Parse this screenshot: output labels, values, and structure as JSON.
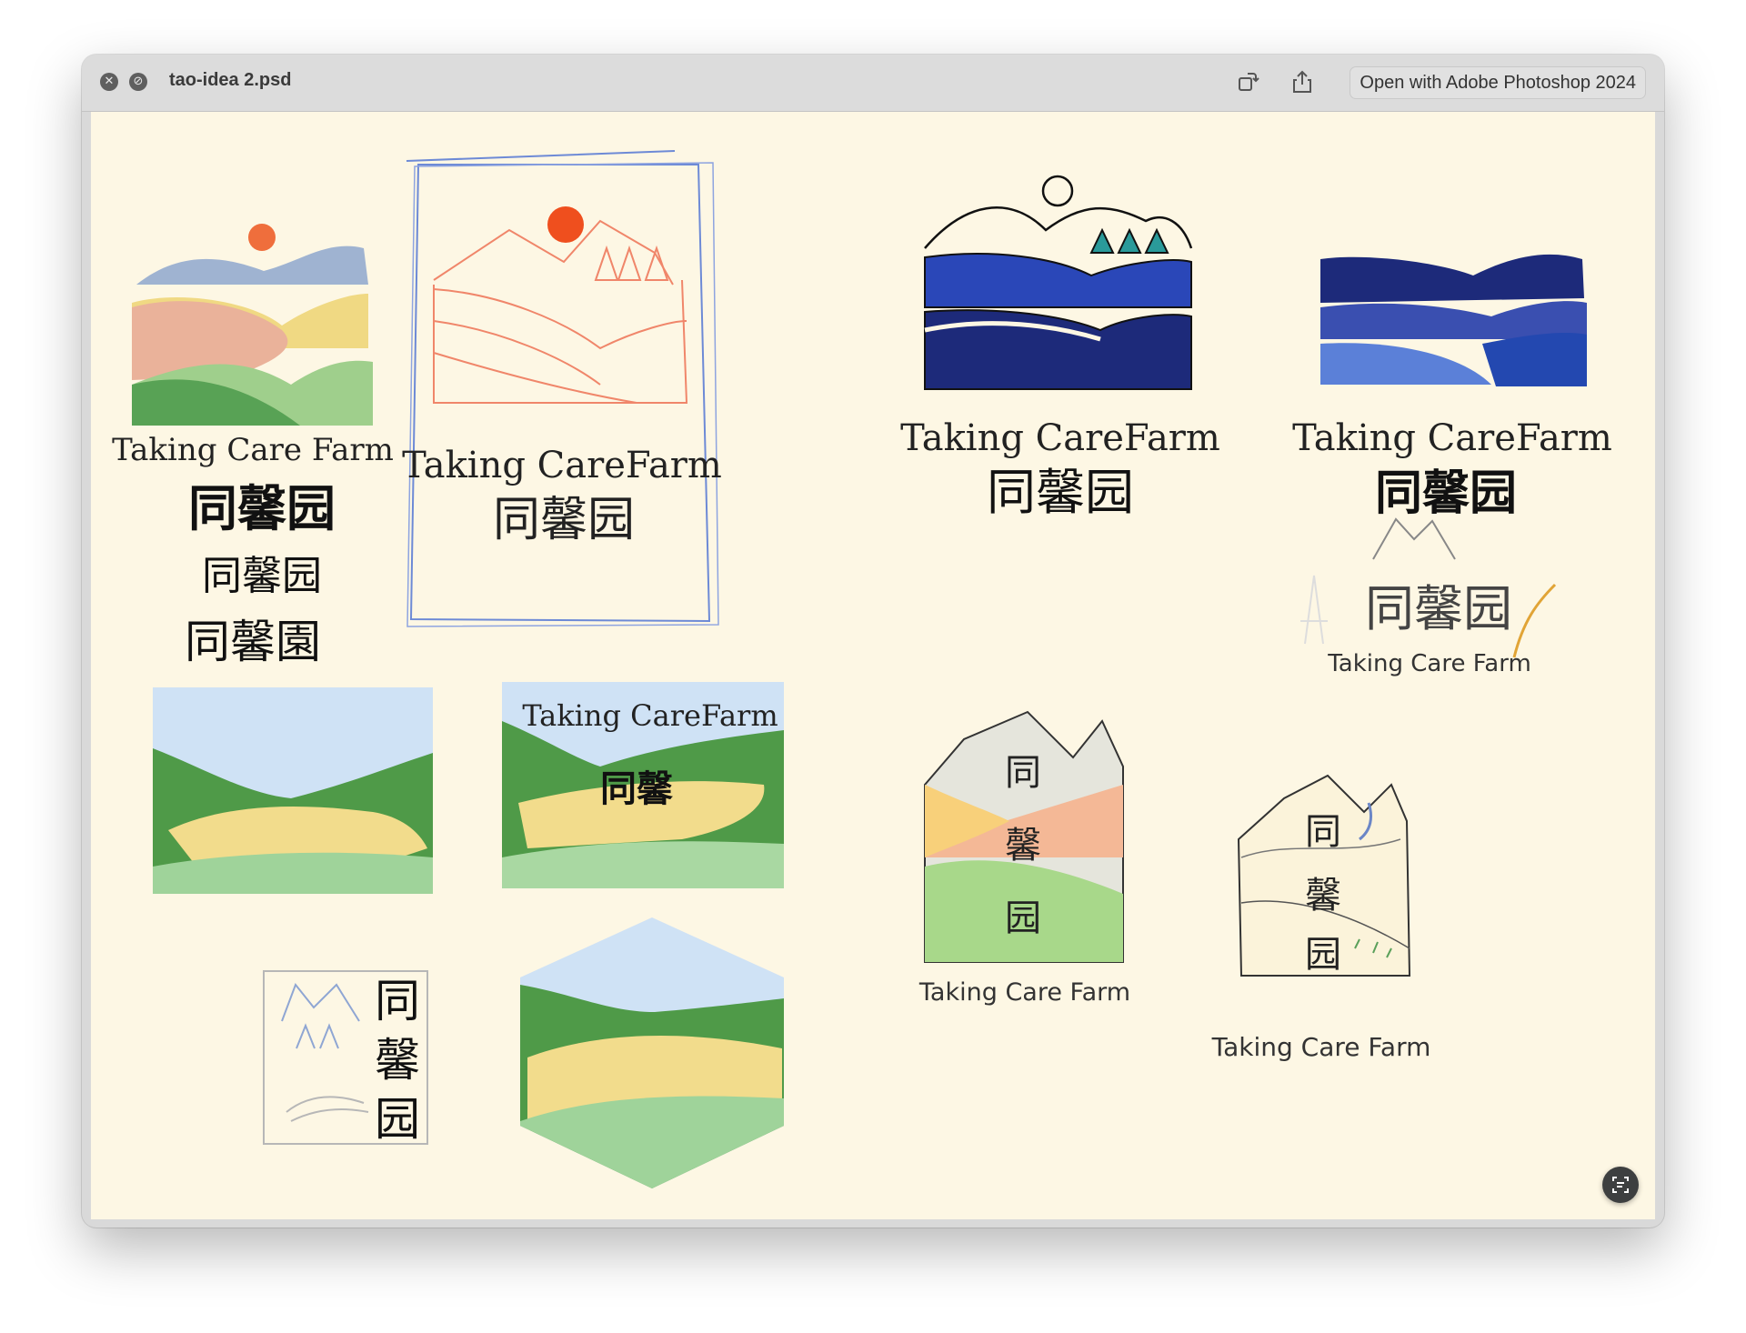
{
  "window": {
    "filename": "tao-idea 2.psd",
    "open_with_label": "Open with Adobe Photoshop 2024"
  },
  "titlebar_icons": [
    "close-icon",
    "no-entry-icon",
    "rotate-icon",
    "share-icon"
  ],
  "artboard": {
    "logo1": {
      "english": "Taking Care Farm",
      "chinese_bold": "同馨园",
      "chinese_script_1": "同馨园",
      "chinese_script_2": "同馨園"
    },
    "logo2": {
      "english": "Taking CareFarm",
      "chinese": "同馨园"
    },
    "logo3": {
      "english": "Taking CareFarm",
      "chinese": "同馨园"
    },
    "logo4": {
      "english": "Taking CareFarm",
      "chinese": "同馨园"
    },
    "logo5": {
      "chinese": "同馨园",
      "english": "Taking Care Farm"
    },
    "landscape_card": {
      "english": "Taking CareFarm",
      "chinese": "同馨"
    },
    "vertical_logo": {
      "c1": "同",
      "c2": "馨",
      "c3": "园"
    },
    "mountain_logo_color": {
      "c1": "同",
      "c2": "馨",
      "c3": "园",
      "english": "Taking Care Farm"
    },
    "mountain_logo_line": {
      "c1": "同",
      "c2": "馨",
      "c3": "园",
      "english": "Taking Care Farm"
    }
  },
  "colors": {
    "canvas": "#fdf7e4",
    "navy": "#1d2a7a",
    "royal_blue": "#2b4fbf",
    "field_yellow": "#f2dc8c",
    "field_green": "#4f9a48",
    "sky": "#cfe2f5",
    "sun": "#ef5a26",
    "sketch_blue": "#6d8ad6"
  }
}
